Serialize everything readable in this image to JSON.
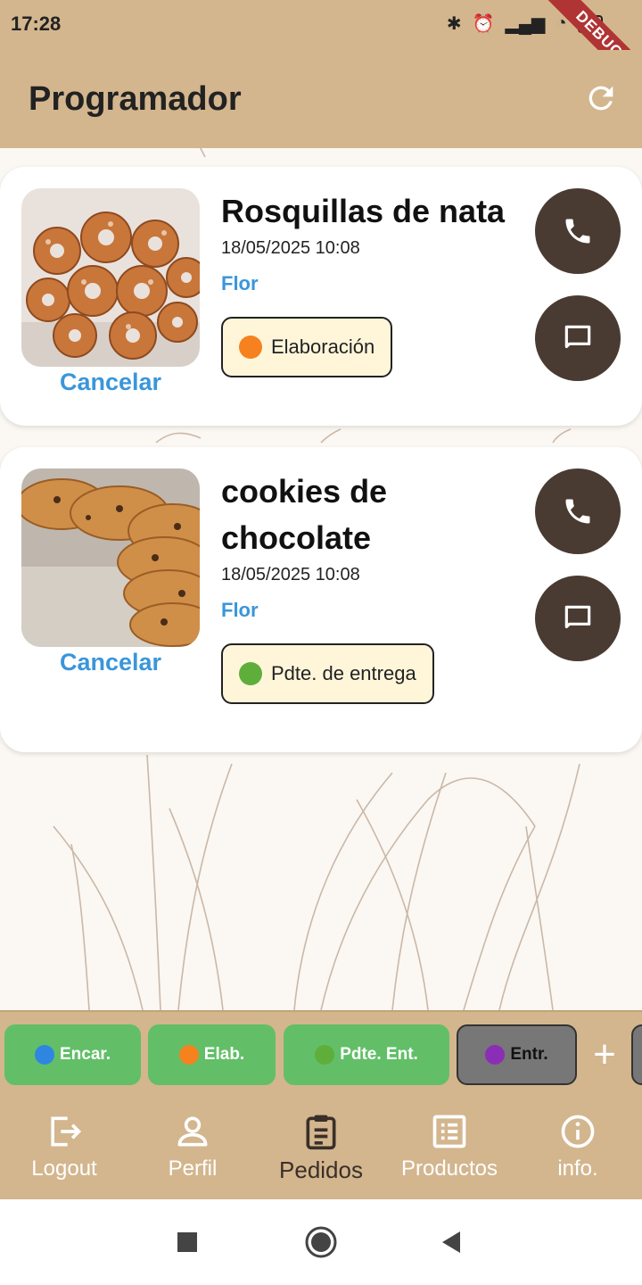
{
  "status_bar": {
    "time": "17:28",
    "battery": "42",
    "debug_label": "DEBUG"
  },
  "app_bar": {
    "title": "Programador"
  },
  "orders": [
    {
      "name": "Rosquillas de nata",
      "date": "18/05/2025 10:08",
      "client": "Flor",
      "status": "Elaboración",
      "status_color": "#f5821f",
      "cancel": "Cancelar"
    },
    {
      "name": "cookies de chocolate",
      "date": "18/05/2025 10:08",
      "client": "Flor",
      "status": "Pdte. de entrega",
      "status_color": "#5fae3c",
      "cancel": "Cancelar"
    }
  ],
  "filters": [
    {
      "label": "Encar.",
      "color": "#2f86e0"
    },
    {
      "label": "Elab.",
      "color": "#f5821f"
    },
    {
      "label": "Pdte. Ent.",
      "color": "#5fae3c"
    },
    {
      "label": "Entr.",
      "color": "#8a2fb5"
    }
  ],
  "add_label": "+",
  "nav": [
    {
      "label": "Logout",
      "icon": "logout-icon"
    },
    {
      "label": "Perfil",
      "icon": "person-icon"
    },
    {
      "label": "Pedidos",
      "icon": "clipboard-icon"
    },
    {
      "label": "Productos",
      "icon": "list-icon"
    },
    {
      "label": "info.",
      "icon": "info-icon"
    }
  ],
  "colors": {
    "header": "#d3b68e",
    "accent_button": "#4a3b32",
    "link": "#3a96da",
    "chip_green": "#62bf68"
  }
}
